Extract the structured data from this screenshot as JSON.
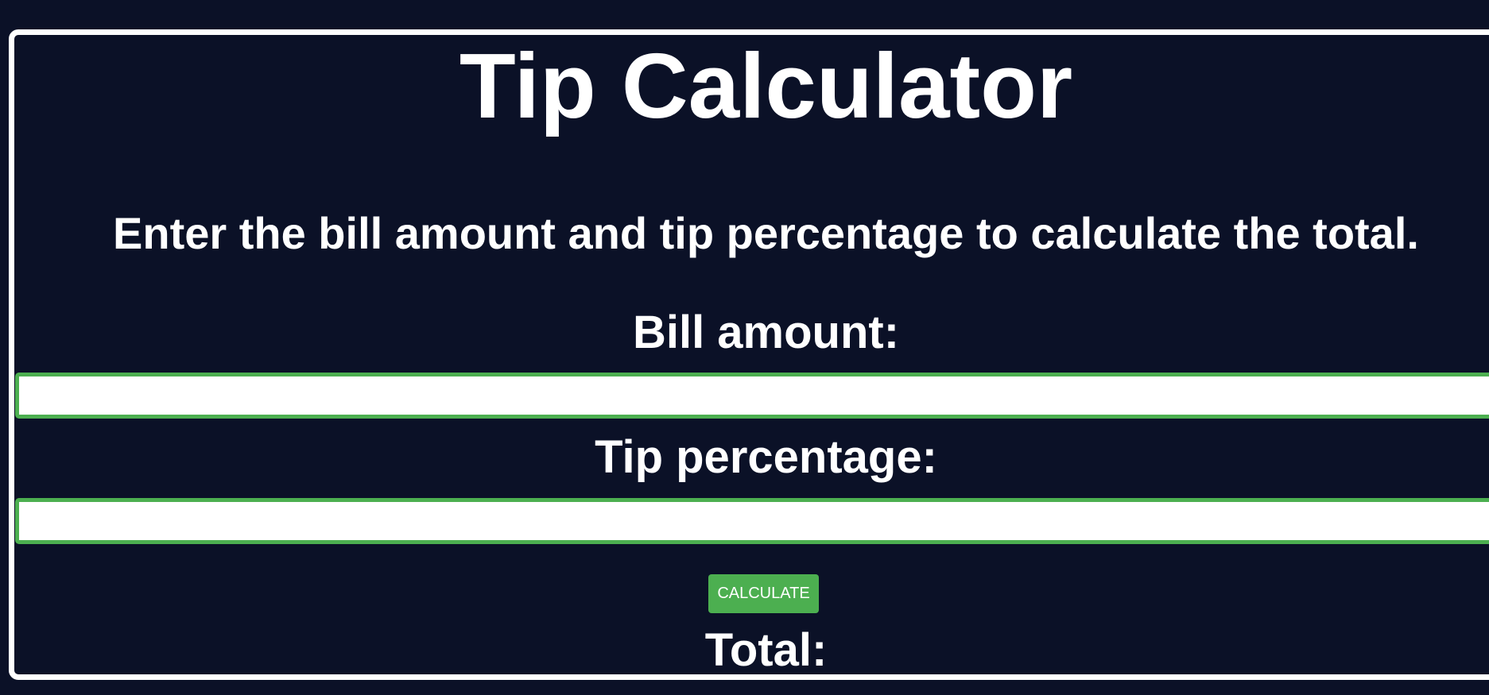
{
  "page": {
    "title": "Tip Calculator",
    "instructions": "Enter the bill amount and tip percentage to calculate the total."
  },
  "form": {
    "bill_label": "Bill amount:",
    "bill_value": "",
    "tip_label": "Tip percentage:",
    "tip_value": "",
    "calculate_label": "CALCULATE"
  },
  "result": {
    "total_label": "Total:"
  },
  "colors": {
    "background": "#0b1127",
    "accent": "#4caf50",
    "text": "#ffffff",
    "card_border": "#ffffff"
  }
}
